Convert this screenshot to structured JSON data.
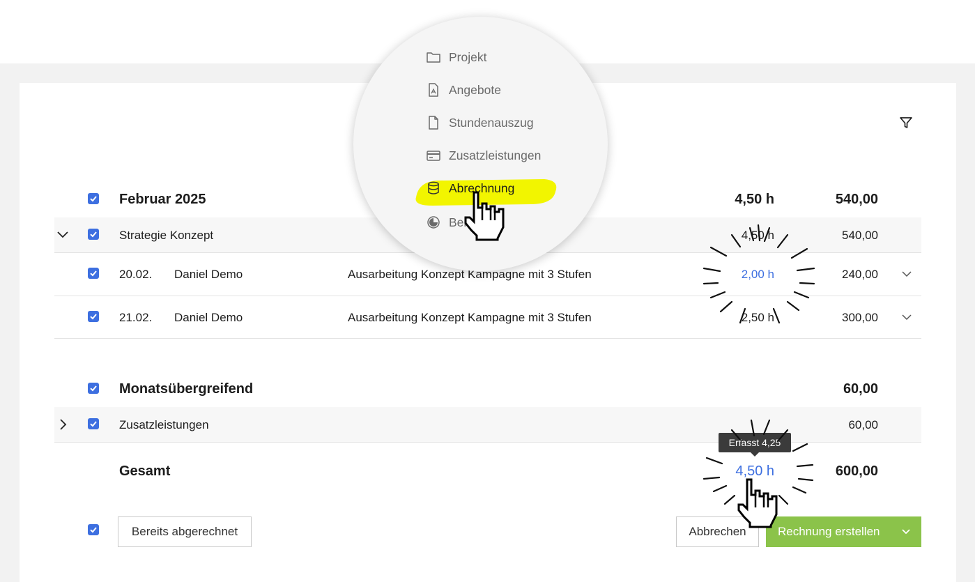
{
  "menu": {
    "items": [
      {
        "label": "Projekt",
        "icon": "folder-icon"
      },
      {
        "label": "Angebote",
        "icon": "offer-document-icon"
      },
      {
        "label": "Stundenauszug",
        "icon": "document-icon"
      },
      {
        "label": "Zusatzleistungen",
        "icon": "credit-card-icon"
      },
      {
        "label": "Abrechnung",
        "icon": "database-icon"
      },
      {
        "label": "Ber",
        "icon": "report-icon"
      }
    ],
    "highlight_color": "#f2f500"
  },
  "groups": {
    "february": {
      "title": "Februar 2025",
      "hours": "4,50 h",
      "amount": "540,00",
      "project": {
        "name": "Strategie Konzept",
        "hours": "4,50 h",
        "amount": "540,00"
      },
      "entries": [
        {
          "date": "20.02.",
          "person": "Daniel Demo",
          "description": "Ausarbeitung Konzept Kampagne mit 3 Stufen",
          "hours": "2,00 h",
          "amount": "240,00"
        },
        {
          "date": "21.02.",
          "person": "Daniel Demo",
          "description": "Ausarbeitung Konzept Kampagne mit 3 Stufen",
          "hours": "2,50 h",
          "amount": "300,00"
        }
      ]
    },
    "cross_month": {
      "title": "Monatsübergreifend",
      "amount": "60,00",
      "extras": {
        "name": "Zusatzleistungen",
        "amount": "60,00"
      }
    }
  },
  "total": {
    "label": "Gesamt",
    "hours": "4,50 h",
    "amount": "600,00"
  },
  "tooltip": {
    "text": "Erfasst 4,25"
  },
  "footer": {
    "already_billed_label": "Bereits abgerechnet",
    "cancel_label": "Abbrechen",
    "create_invoice_label": "Rechnung erstellen"
  },
  "colors": {
    "accent": "#3d6fe0",
    "primary_button": "#8bc34a",
    "background": "#f2f2f2"
  }
}
